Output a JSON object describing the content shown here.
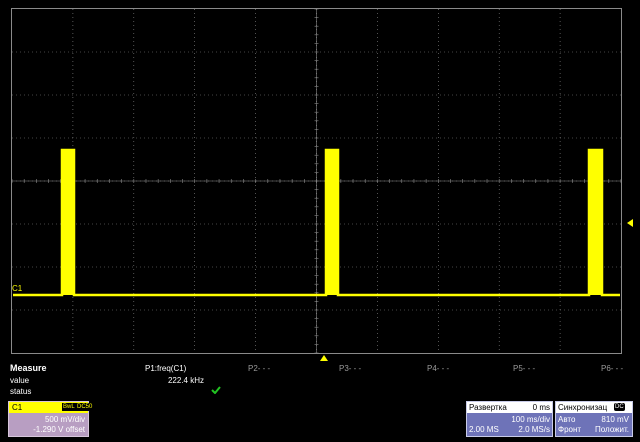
{
  "screen": {
    "trace_label": "C1",
    "trace_color": "#ffff00",
    "background_color": "#000000",
    "grid_color": "#8a8a8a",
    "waveform": {
      "description_values": {
        "pulses_count": 3
      }
    }
  },
  "measure": {
    "title": "Measure",
    "rows": {
      "value_label": "value",
      "status_label": "status"
    },
    "params": {
      "p1": {
        "label": "P1:freq(C1)",
        "value": "222.4 kHz",
        "status_icon": "check-icon"
      },
      "p2": {
        "label": "P2- - -"
      },
      "p3": {
        "label": "P3- - -"
      },
      "p4": {
        "label": "P4- - -"
      },
      "p5": {
        "label": "P5- - -"
      },
      "p6": {
        "label": "P6- - -"
      }
    }
  },
  "channel": {
    "name": "C1",
    "bwl_badge": "BwL",
    "coupling_badge": "DC50",
    "vdiv": "500 mV/div",
    "offset": "-1.290 V offset"
  },
  "timebase": {
    "title": "Развертка",
    "delay": "0 ms",
    "tdiv": "100 ms/div",
    "points": "2.00 MS",
    "rate": "2.0 MS/s"
  },
  "trigger": {
    "title": "Синхронизац",
    "badge": "DC",
    "mode": "Авто",
    "level": "810 mV",
    "edge_label": "Фронт",
    "slope": "Положит."
  }
}
